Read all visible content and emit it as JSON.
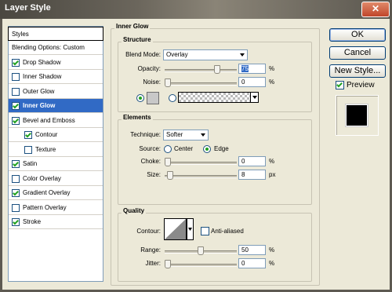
{
  "window": {
    "title": "Layer Style",
    "close_glyph": "✕"
  },
  "styles_list": {
    "header": "Styles",
    "items": [
      {
        "label": "Blending Options: Custom",
        "checkbox": false,
        "checked": false,
        "selected": false
      },
      {
        "label": "Drop Shadow",
        "checkbox": true,
        "checked": true,
        "selected": false
      },
      {
        "label": "Inner Shadow",
        "checkbox": true,
        "checked": false,
        "selected": false
      },
      {
        "label": "Outer Glow",
        "checkbox": true,
        "checked": false,
        "selected": false
      },
      {
        "label": "Inner Glow",
        "checkbox": true,
        "checked": true,
        "selected": true
      },
      {
        "label": "Bevel and Emboss",
        "checkbox": true,
        "checked": true,
        "selected": false
      },
      {
        "label": "Contour",
        "checkbox": true,
        "checked": true,
        "selected": false,
        "indent": true
      },
      {
        "label": "Texture",
        "checkbox": true,
        "checked": false,
        "selected": false,
        "indent": true
      },
      {
        "label": "Satin",
        "checkbox": true,
        "checked": true,
        "selected": false
      },
      {
        "label": "Color Overlay",
        "checkbox": true,
        "checked": false,
        "selected": false
      },
      {
        "label": "Gradient Overlay",
        "checkbox": true,
        "checked": true,
        "selected": false
      },
      {
        "label": "Pattern Overlay",
        "checkbox": true,
        "checked": false,
        "selected": false
      },
      {
        "label": "Stroke",
        "checkbox": true,
        "checked": true,
        "selected": false
      }
    ]
  },
  "inner_glow": {
    "title": "Inner Glow",
    "structure": {
      "title": "Structure",
      "blend_mode_label": "Blend Mode:",
      "blend_mode_value": "Overlay",
      "opacity_label": "Opacity:",
      "opacity_value": "75",
      "opacity_pct": 0.75,
      "noise_label": "Noise:",
      "noise_value": "0",
      "noise_pct": 0.0,
      "unit_pct": "%"
    },
    "elements": {
      "title": "Elements",
      "technique_label": "Technique:",
      "technique_value": "Softer",
      "source_label": "Source:",
      "source_center": "Center",
      "source_edge": "Edge",
      "choke_label": "Choke:",
      "choke_value": "0",
      "choke_pct": 0.0,
      "size_label": "Size:",
      "size_value": "8",
      "size_pct": 0.032,
      "unit_pct": "%",
      "unit_px": "px"
    },
    "quality": {
      "title": "Quality",
      "contour_label": "Contour:",
      "anti_aliased_label": "Anti-aliased",
      "range_label": "Range:",
      "range_value": "50",
      "range_pct": 0.5,
      "jitter_label": "Jitter:",
      "jitter_value": "0",
      "jitter_pct": 0.0,
      "unit_pct": "%"
    }
  },
  "buttons": {
    "ok": "OK",
    "cancel": "Cancel",
    "new_style": "New Style...",
    "preview": "Preview"
  },
  "colors": {
    "accent_selected": "#316ac5",
    "dialog_bg": "#ece9d8",
    "check_green": "#21a121"
  }
}
